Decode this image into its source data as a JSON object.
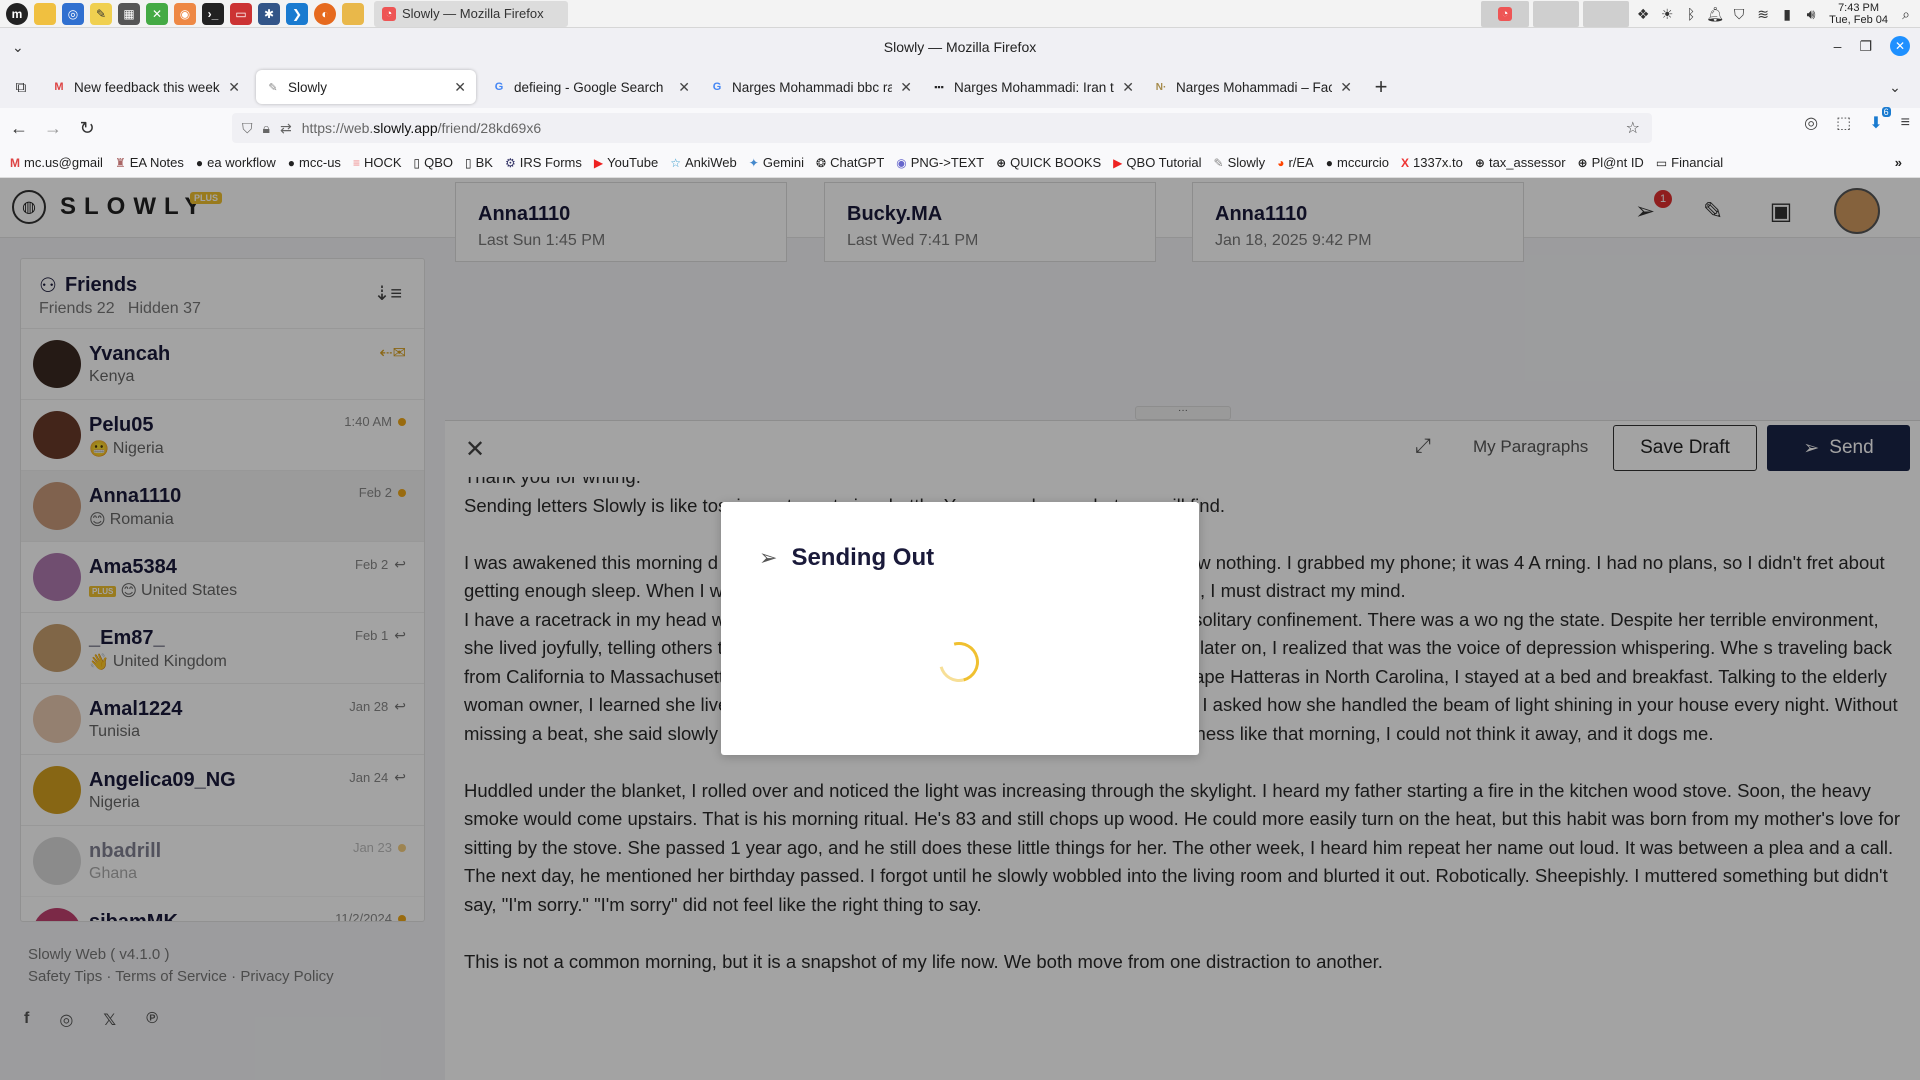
{
  "os": {
    "active_window_label": "Slowly — Mozilla Firefox",
    "clock_time": "7:43 PM",
    "clock_date": "Tue, Feb 04"
  },
  "window": {
    "title": "Slowly — Mozilla Firefox"
  },
  "tabs": [
    {
      "label": "New feedback this week for",
      "favicon": "gmail-icon"
    },
    {
      "label": "Slowly",
      "favicon": "slowly-icon",
      "active": true
    },
    {
      "label": "defieing - Google Search",
      "favicon": "google-icon"
    },
    {
      "label": "Narges Mohammadi bbc rad",
      "favicon": "google-icon"
    },
    {
      "label": "Narges Mohammadi: Iran te",
      "favicon": "bbc-icon"
    },
    {
      "label": "Narges Mohammadi – Facts",
      "favicon": "nobel-icon"
    }
  ],
  "url": {
    "prefix": "https://web.",
    "host": "slowly.app",
    "path": "/friend/28kd69x6"
  },
  "nav": {
    "downloads_badge": "6"
  },
  "bookmarks": [
    {
      "label": "mc.us@gmail",
      "icon": "gmail-icon"
    },
    {
      "label": "EA Notes",
      "icon": "bookmark-icon"
    },
    {
      "label": "ea workflow",
      "icon": "github-icon"
    },
    {
      "label": "mcc-us",
      "icon": "github-icon"
    },
    {
      "label": "HOCK",
      "icon": "bookmark-icon"
    },
    {
      "label": "QBO",
      "icon": "book-icon"
    },
    {
      "label": "BK",
      "icon": "book-icon"
    },
    {
      "label": "IRS Forms",
      "icon": "irs-icon"
    },
    {
      "label": "YouTube",
      "icon": "youtube-icon"
    },
    {
      "label": "AnkiWeb",
      "icon": "star-icon"
    },
    {
      "label": "Gemini",
      "icon": "gemini-icon"
    },
    {
      "label": "ChatGPT",
      "icon": "chatgpt-icon"
    },
    {
      "label": "PNG->TEXT",
      "icon": "circle-icon"
    },
    {
      "label": "QUICK BOOKS",
      "icon": "globe-icon"
    },
    {
      "label": "QBO Tutorial",
      "icon": "youtube-icon"
    },
    {
      "label": "Slowly",
      "icon": "slowly-icon"
    },
    {
      "label": "r/EA",
      "icon": "reddit-icon"
    },
    {
      "label": "mccurcio",
      "icon": "github-icon"
    },
    {
      "label": "1337x.to",
      "icon": "x-icon"
    },
    {
      "label": "tax_assessor",
      "icon": "globe-icon"
    },
    {
      "label": "Pl@nt ID",
      "icon": "globe-icon"
    },
    {
      "label": "Financial",
      "icon": "folder-icon"
    }
  ],
  "app": {
    "logo_text": "SLOWLY",
    "logo_badge": "PLUS",
    "notification_count": "1"
  },
  "friends_panel": {
    "title": "Friends",
    "counts": "Friends 22   Hidden 37",
    "items": [
      {
        "name": "Yvancah",
        "country": "Kenya",
        "date": "",
        "status": "incoming-letter",
        "avatar_color": "#3b2a22"
      },
      {
        "name": "Pelu05",
        "country": "Nigeria",
        "emoji": "😬",
        "date": "1:40 AM",
        "status": "dot",
        "avatar_color": "#6a3a2a"
      },
      {
        "name": "Anna1110",
        "country": "Romania",
        "emoji": "😊",
        "date": "Feb 2",
        "status": "dot",
        "avatar_color": "#c89a7a",
        "selected": true
      },
      {
        "name": "Ama5384",
        "country": "United States",
        "emoji": "😊",
        "plus": "PLUS",
        "date": "Feb 2",
        "status": "reply",
        "avatar_color": "#b07ab0"
      },
      {
        "name": "_Em87_",
        "country": "United Kingdom",
        "emoji": "👋",
        "date": "Feb 1",
        "status": "reply",
        "avatar_color": "#c8a070"
      },
      {
        "name": "Amal1224",
        "country": "Tunisia",
        "date": "Jan 28",
        "status": "reply",
        "avatar_color": "#e8c8b0"
      },
      {
        "name": "Angelica09_NG",
        "country": "Nigeria",
        "date": "Jan 24",
        "status": "reply",
        "avatar_color": "#d4a020"
      },
      {
        "name": "nbadrill",
        "country": "Ghana",
        "date": "Jan 23",
        "status": "dot",
        "avatar_color": "#bbbbbb",
        "faded": true
      },
      {
        "name": "sibamMK",
        "country": "",
        "date": "11/2/2024",
        "status": "dot",
        "avatar_color": "#c04070"
      }
    ]
  },
  "footer": {
    "version": "Slowly Web ( v4.1.0 )",
    "links": [
      "Safety Tips",
      "Terms of Service",
      "Privacy Policy"
    ],
    "social": [
      "facebook-icon",
      "instagram-icon",
      "x-icon",
      "pinterest-icon"
    ]
  },
  "cards": [
    {
      "name": "Anna1110",
      "date": "Last Sun 1:45 PM"
    },
    {
      "name": "Bucky.MA",
      "date": "Last Wed 7:41 PM"
    },
    {
      "name": "Anna1110",
      "date": "Jan 18, 2025 9:42 PM"
    }
  ],
  "composer": {
    "my_paragraphs": "My Paragraphs",
    "save_draft": "Save Draft",
    "send": "Send",
    "paragraphs": [
      "Thank you for writing.",
      "Sending letters Slowly is like tossing out a note in a bottle. You never know what you will find.",
      "",
      "I was awakened this morning                                                                    d tightening around my waist. I looked at the skylight and saw nothing. I grabbed my phone; it was 4 A                                                                    rning. I had no plans, so I didn't fret about getting enough sleep. When I was a little boy, I loved going to bed                                                                    . Now, when I go to bed, I must distract my mind.",
      "I have a racetrack in my head                                                                    women in an Iranian jail, I wondered if I would crack under solitary confinement. There was a wo                                                                    ng the state. Despite her terrible environment, she lived joyfully, telling others to be peaceful and love each                                                                    found it hard to be joyful. But later on, I realized that was the voice of depression whispering. Whe                                                                    s traveling back from California to Massachusetts, and I spent an entire month driving back. Stopping in Cape Hatteras in North Carolina, I stayed at a bed and breakfast. Talking to the elderly woman owner, I learned she lived and worked at the famous lighthouse with her husband. I asked how she handled the beam of light shining in your house every night. Without missing a beat, she said slowly and firmly, \"You had to think it away.\" At moments of weakness like that morning, I could not think it away, and it dogs me.",
      "",
      "Huddled under the blanket, I rolled over and noticed the light was increasing through the skylight. I heard my father starting a fire in the kitchen wood stove. Soon, the heavy smoke would come upstairs. That is his morning ritual. He's 83 and still chops up wood. He could more easily turn on the heat, but this habit was born from my mother's love for sitting by the stove. She passed 1 year ago, and he still does these little things for her. The other week, I heard him repeat her name out loud. It was between a plea and a call.  The next day, he mentioned her birthday passed.  I forgot until he slowly wobbled into the living room and blurted it out. Robotically. Sheepishly. I muttered something but didn't say, \"I'm sorry.\" \"I'm sorry\" did not feel like the right thing to say.",
      "",
      "This is not a common morning, but it is a snapshot of my life now. We both move from one distraction to another."
    ]
  },
  "modal": {
    "title": "Sending Out"
  },
  "colors": {
    "accent": "#f0c030",
    "primary": "#1a2447",
    "overlay": "rgba(0,0,0,0.36)"
  }
}
